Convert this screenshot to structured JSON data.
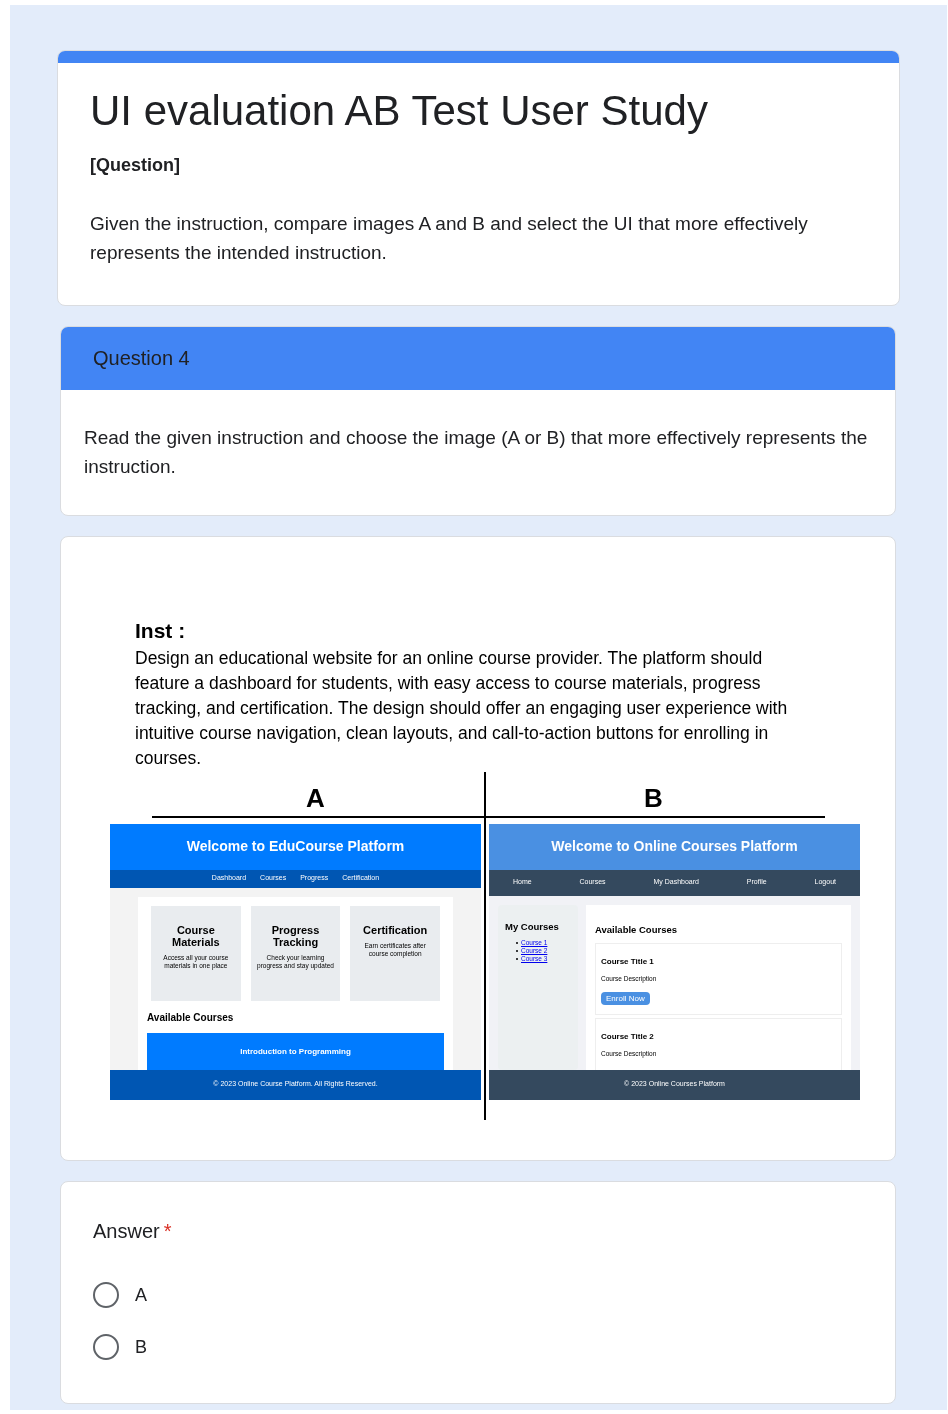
{
  "form": {
    "title": "UI evaluation AB Test User Study",
    "question_label": "[Question]",
    "description": "Given the instruction, compare images A and B and select the UI that more effectively represents the intended instruction."
  },
  "section": {
    "title": "Question 4",
    "description": "Read the given instruction and choose the image (A or B) that more effectively represents the instruction."
  },
  "figure": {
    "inst_label": "Inst :",
    "inst_text": "Design an educational website for an online course provider. The platform should feature a dashboard for students, with easy access to course materials, progress tracking, and certification. The design should offer an engaging user experience with intuitive course navigation, clean layouts, and call-to-action buttons for enrolling in courses.",
    "option_a": {
      "label": "A",
      "header": "Welcome to EduCourse Platform",
      "nav": [
        "Dashboard",
        "Courses",
        "Progress",
        "Certification"
      ],
      "cards": [
        {
          "title": "Course Materials",
          "text": "Access all your course materials in one place"
        },
        {
          "title": "Progress Tracking",
          "text": "Check your learning progress and stay updated"
        },
        {
          "title": "Certification",
          "text": "Earn certificates after course completion"
        }
      ],
      "section_title": "Available Courses",
      "course_button": "Introduction to Programming",
      "footer": "© 2023 Online Course Platform. All Rights Reserved."
    },
    "option_b": {
      "label": "B",
      "header": "Welcome to Online Courses Platform",
      "nav": [
        "Home",
        "Courses",
        "My Dashboard",
        "Profile",
        "Logout"
      ],
      "sidebar_title": "My Courses",
      "sidebar_links": [
        "Course 1",
        "Course 2",
        "Course 3"
      ],
      "section_title": "Available Courses",
      "courses": [
        {
          "title": "Course Title 1",
          "description": "Course Description",
          "button": "Enroll Now"
        },
        {
          "title": "Course Title 2",
          "description": "Course Description"
        }
      ],
      "footer": "© 2023 Online Courses Platform"
    }
  },
  "answer": {
    "label": "Answer",
    "required_mark": "*",
    "options": [
      {
        "label": "A",
        "selected": false
      },
      {
        "label": "B",
        "selected": false
      }
    ]
  }
}
